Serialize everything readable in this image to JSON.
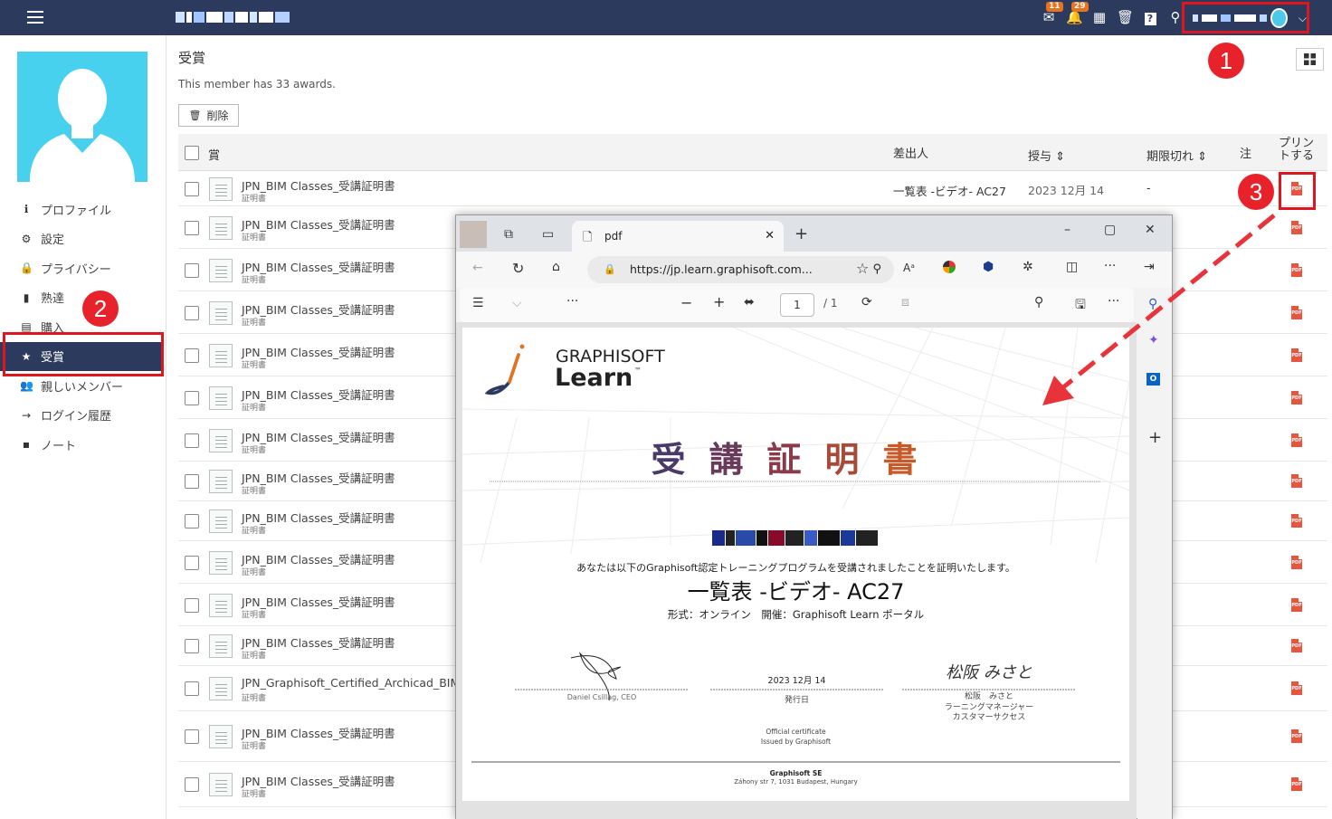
{
  "topbar": {
    "notification_badges": {
      "mail": "11",
      "bell": "29"
    },
    "icons": [
      "mail-icon",
      "bell-icon",
      "calendar-icon",
      "trash-icon",
      "help-icon",
      "search-icon"
    ],
    "user_chip_chevron": "⌵"
  },
  "markers": {
    "m1": "1",
    "m2": "2",
    "m3": "3"
  },
  "sidebar": {
    "items": [
      {
        "label": "プロファイル",
        "icon": "info-icon",
        "glyph": "ℹ"
      },
      {
        "label": "設定",
        "icon": "gear-icon",
        "glyph": "⚙"
      },
      {
        "label": "プライバシー",
        "icon": "lock-icon",
        "glyph": "🔒"
      },
      {
        "label": "熟達",
        "icon": "bar-chart-icon",
        "glyph": "▮"
      },
      {
        "label": "購入",
        "icon": "stack-icon",
        "glyph": "▤"
      },
      {
        "label": "受賞",
        "icon": "star-icon",
        "glyph": "★"
      },
      {
        "label": "親しいメンバー",
        "icon": "users-icon",
        "glyph": "👥"
      },
      {
        "label": "ログイン履歴",
        "icon": "arrow-right-icon",
        "glyph": "→"
      },
      {
        "label": "ノート",
        "icon": "note-icon",
        "glyph": "▪"
      }
    ]
  },
  "main": {
    "title": "受賞",
    "subtitle": "This member has 33 awards.",
    "delete_label": "削除",
    "columns": {
      "award": "賞",
      "issuer": "差出人",
      "issued": "授与 ⇕",
      "expires": "期限切れ ⇕",
      "note": "注",
      "print": "プリントする"
    },
    "rows": [
      {
        "name": "JPN_BIM Classes_受講証明書",
        "type": "証明書",
        "issuer": "一覧表 -ビデオ- AC27",
        "issued": "2023 12月 14",
        "expires": "-"
      },
      {
        "name": "JPN_BIM Classes_受講証明書",
        "type": "証明書"
      },
      {
        "name": "JPN_BIM Classes_受講証明書",
        "type": "証明書"
      },
      {
        "name": "JPN_BIM Classes_受講証明書",
        "type": "証明書"
      },
      {
        "name": "JPN_BIM Classes_受講証明書",
        "type": "証明書"
      },
      {
        "name": "JPN_BIM Classes_受講証明書",
        "type": "証明書"
      },
      {
        "name": "JPN_BIM Classes_受講証明書",
        "type": "証明書"
      },
      {
        "name": "JPN_BIM Classes_受講証明書",
        "type": "証明書"
      },
      {
        "name": "JPN_BIM Classes_受講証明書",
        "type": "証明書"
      },
      {
        "name": "JPN_BIM Classes_受講証明書",
        "type": "証明書"
      },
      {
        "name": "JPN_BIM Classes_受講証明書",
        "type": "証明書"
      },
      {
        "name": "JPN_BIM Classes_受講証明書",
        "type": "証明書"
      },
      {
        "name": "JPN_Graphisoft_Certified_Archicad_BIM",
        "type": "証明書"
      },
      {
        "name": "JPN_BIM Classes_受講証明書",
        "type": "証明書"
      },
      {
        "name": "JPN_BIM Classes_受講証明書",
        "type": "証明書"
      }
    ],
    "pdf_label": "PDF"
  },
  "browser": {
    "tab_title": "pdf",
    "url": "https://jp.learn.graphisoft.com...",
    "page_current": "1",
    "page_total": "/ 1",
    "certificate": {
      "brand_top": "GRAPHISOFT",
      "brand_bottom": "Learn",
      "tm": "™",
      "title_chars": [
        "受",
        "講",
        "証",
        "明",
        "書"
      ],
      "statement": "あなたは以下のGraphisoft認定トレーニングプログラムを受講されましたことを証明いたします。",
      "course": "一覧表 -ビデオ- AC27",
      "format": "形式：オンライン　開催：Graphisoft Learn ポータル",
      "sign_left_name": "Daniel Csillag, CEO",
      "date": "2023 12月 14",
      "date_label": "発行日",
      "sign_right_script": "松阪 みさと",
      "sign_right_name": "松阪　みさと",
      "sign_right_role1": "ラーニングマネージャー",
      "sign_right_role2": "カスタマーサクセス",
      "official1": "Official certificate",
      "official2": "Issued by Graphisoft",
      "company": "Graphisoft SE",
      "address": "Záhony str 7, 1031 Budapest, Hungary"
    }
  },
  "colors": {
    "topbar": "#2c3a5e",
    "accent_red": "#e0161e",
    "avatar_bg": "#47d1ee",
    "pdf_red": "#e8553f",
    "badge": "#e8731f"
  }
}
